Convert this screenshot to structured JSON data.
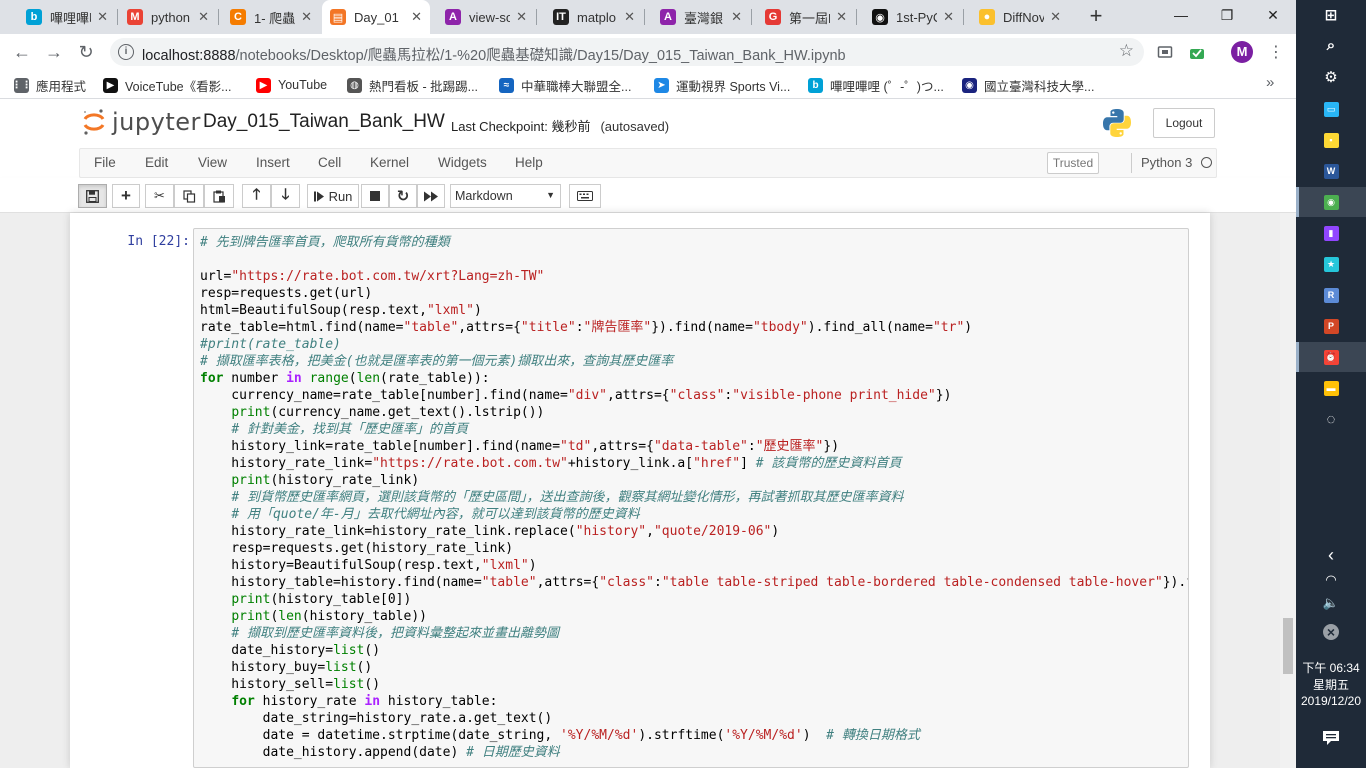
{
  "browser": {
    "tabs": [
      {
        "title": "嗶哩嗶哩",
        "icon": "bilibili-icon",
        "color": "#00a1d6",
        "glyph": "b"
      },
      {
        "title": "python",
        "icon": "gmail-icon",
        "color": "#ea4335",
        "glyph": "M"
      },
      {
        "title": "1- 爬蟲",
        "icon": "loading-icon",
        "color": "#f57c00",
        "glyph": "C"
      },
      {
        "title": "Day_01",
        "icon": "notebook-icon",
        "color": "#f37626",
        "glyph": "▤"
      },
      {
        "title": "view-so",
        "icon": "archive-icon",
        "color": "#8e24aa",
        "glyph": "A"
      },
      {
        "title": "matplo",
        "icon": "ithome-icon",
        "color": "#222222",
        "glyph": "IT"
      },
      {
        "title": "臺灣銀",
        "icon": "archive-icon",
        "color": "#8e24aa",
        "glyph": "A"
      },
      {
        "title": "第一屆P",
        "icon": "google-icon",
        "color": "#e53935",
        "glyph": "G"
      },
      {
        "title": "1st-PyC",
        "icon": "github-icon",
        "color": "#111111",
        "glyph": "◉"
      },
      {
        "title": "DiffNov",
        "icon": "lemon-icon",
        "color": "#fbc02d",
        "glyph": "●"
      }
    ],
    "window_controls": [
      "—",
      "❐",
      "✕"
    ],
    "url_host": "localhost:8888",
    "url_path": "/notebooks/Desktop/爬蟲馬拉松/1-%20爬蟲基礎知識/Day15/Day_015_Taiwan_Bank_HW.ipynb",
    "profile_initial": "M",
    "bookmarks": [
      {
        "label": "應用程式",
        "icon": "apps-grid-icon",
        "color": "#5f6368",
        "glyph": "⋮⋮"
      },
      {
        "label": "VoiceTube《看影...",
        "icon": "voicetube-icon",
        "color": "#111111",
        "glyph": "▶"
      },
      {
        "label": "YouTube",
        "icon": "youtube-icon",
        "color": "#ff0000",
        "glyph": "▶"
      },
      {
        "label": "熱門看板 - 批踢踢...",
        "icon": "globe-icon",
        "color": "#555555",
        "glyph": "◍"
      },
      {
        "label": "中華職棒大聯盟全...",
        "icon": "cpbl-icon",
        "color": "#1565c0",
        "glyph": "≈"
      },
      {
        "label": "運動視界 Sports Vi...",
        "icon": "sportsv-icon",
        "color": "#1e88e5",
        "glyph": "➤"
      },
      {
        "label": "嗶哩嗶哩 (゜-゜)つ...",
        "icon": "bilibili-icon",
        "color": "#00a1d6",
        "glyph": "b"
      },
      {
        "label": "國立臺灣科技大學...",
        "icon": "ntust-icon",
        "color": "#1a237e",
        "glyph": "◉"
      }
    ]
  },
  "jupyter": {
    "logo_text": "jupyter",
    "notebook_name": "Day_015_Taiwan_Bank_HW",
    "checkpoint_label": "Last Checkpoint: 幾秒前",
    "autosave": "(autosaved)",
    "logout_label": "Logout",
    "menus": [
      "File",
      "Edit",
      "View",
      "Insert",
      "Cell",
      "Kernel",
      "Widgets",
      "Help"
    ],
    "trusted_label": "Trusted",
    "kernel_name": "Python 3",
    "run_label": "Run",
    "cell_type": "Markdown",
    "prompt": "In [22]:",
    "code_lines": [
      [
        [
          "cm",
          "# 先到牌告匯率首頁，爬取所有貨幣的種類"
        ]
      ],
      [
        [
          "",
          ""
        ]
      ],
      [
        [
          "",
          "url="
        ],
        [
          "st",
          "\"https://rate.bot.com.tw/xrt?Lang=zh-TW\""
        ]
      ],
      [
        [
          "",
          "resp=requests.get(url)"
        ]
      ],
      [
        [
          "",
          "html=BeautifulSoup(resp.text,"
        ],
        [
          "st",
          "\"lxml\""
        ],
        [
          "",
          ")"
        ]
      ],
      [
        [
          "",
          "rate_table=html.find(name="
        ],
        [
          "st",
          "\"table\""
        ],
        [
          "",
          ",attrs={"
        ],
        [
          "st",
          "\"title\""
        ],
        [
          "",
          ":"
        ],
        [
          "st",
          "\"牌告匯率\""
        ],
        [
          "",
          "}).find(name="
        ],
        [
          "st",
          "\"tbody\""
        ],
        [
          "",
          ").find_all(name="
        ],
        [
          "st",
          "\"tr\""
        ],
        [
          "",
          ")"
        ]
      ],
      [
        [
          "cm",
          "#print(rate_table)"
        ]
      ],
      [
        [
          "cm",
          "# 擷取匯率表格，把美金(也就是匯率表的第一個元素)擷取出來，查詢其歷史匯率"
        ]
      ],
      [
        [
          "kw",
          "for"
        ],
        [
          "",
          " number "
        ],
        [
          "op",
          "in"
        ],
        [
          "",
          " "
        ],
        [
          "bi",
          "range"
        ],
        [
          "",
          "("
        ],
        [
          "bi",
          "len"
        ],
        [
          "",
          "(rate_table)):"
        ]
      ],
      [
        [
          "",
          "    currency_name=rate_table[number].find(name="
        ],
        [
          "st",
          "\"div\""
        ],
        [
          "",
          ",attrs={"
        ],
        [
          "st",
          "\"class\""
        ],
        [
          "",
          ":"
        ],
        [
          "st",
          "\"visible-phone print_hide\""
        ],
        [
          "",
          "})"
        ]
      ],
      [
        [
          "",
          "    "
        ],
        [
          "bi",
          "print"
        ],
        [
          "",
          "(currency_name.get_text().lstrip())"
        ]
      ],
      [
        [
          "",
          "    "
        ],
        [
          "cm",
          "# 針對美金，找到其「歷史匯率」的首頁"
        ]
      ],
      [
        [
          "",
          "    history_link=rate_table[number].find(name="
        ],
        [
          "st",
          "\"td\""
        ],
        [
          "",
          ",attrs={"
        ],
        [
          "st",
          "\"data-table\""
        ],
        [
          "",
          ":"
        ],
        [
          "st",
          "\"歷史匯率\""
        ],
        [
          "",
          "})"
        ]
      ],
      [
        [
          "",
          "    history_rate_link="
        ],
        [
          "st",
          "\"https://rate.bot.com.tw\""
        ],
        [
          "",
          "+history_link.a["
        ],
        [
          "st",
          "\"href\""
        ],
        [
          "",
          "] "
        ],
        [
          "cm",
          "# 該貨幣的歷史資料首頁"
        ]
      ],
      [
        [
          "",
          "    "
        ],
        [
          "bi",
          "print"
        ],
        [
          "",
          "(history_rate_link)"
        ]
      ],
      [
        [
          "",
          "    "
        ],
        [
          "cm",
          "# 到貨幣歷史匯率網頁，選則該貨幣的「歷史區間」，送出查詢後，觀察其網址變化情形，再試著抓取其歷史匯率資料"
        ]
      ],
      [
        [
          "",
          "    "
        ],
        [
          "cm",
          "# 用「quote/年-月」去取代網址內容，就可以達到該貨幣的歷史資料"
        ]
      ],
      [
        [
          "",
          "    history_rate_link=history_rate_link.replace("
        ],
        [
          "st",
          "\"history\""
        ],
        [
          "",
          ","
        ],
        [
          "st",
          "\"quote/2019-06\""
        ],
        [
          "",
          ")"
        ]
      ],
      [
        [
          "",
          "    resp=requests.get(history_rate_link)"
        ]
      ],
      [
        [
          "",
          "    history=BeautifulSoup(resp.text,"
        ],
        [
          "st",
          "\"lxml\""
        ],
        [
          "",
          ")"
        ]
      ],
      [
        [
          "",
          "    history_table=history.find(name="
        ],
        [
          "st",
          "\"table\""
        ],
        [
          "",
          ",attrs={"
        ],
        [
          "st",
          "\"class\""
        ],
        [
          "",
          ":"
        ],
        [
          "st",
          "\"table table-striped table-bordered table-condensed table-hover\""
        ],
        [
          "",
          "}).fin"
        ]
      ],
      [
        [
          "",
          "    "
        ],
        [
          "bi",
          "print"
        ],
        [
          "",
          "(history_table[0])"
        ]
      ],
      [
        [
          "",
          "    "
        ],
        [
          "bi",
          "print"
        ],
        [
          "",
          "("
        ],
        [
          "bi",
          "len"
        ],
        [
          "",
          "(history_table))"
        ]
      ],
      [
        [
          "",
          "    "
        ],
        [
          "cm",
          "# 擷取到歷史匯率資料後，把資料彙整起來並畫出離勢圖"
        ]
      ],
      [
        [
          "",
          "    date_history="
        ],
        [
          "bi",
          "list"
        ],
        [
          "",
          "()"
        ]
      ],
      [
        [
          "",
          "    history_buy="
        ],
        [
          "bi",
          "list"
        ],
        [
          "",
          "()"
        ]
      ],
      [
        [
          "",
          "    history_sell="
        ],
        [
          "bi",
          "list"
        ],
        [
          "",
          "()"
        ]
      ],
      [
        [
          "",
          "    "
        ],
        [
          "kw",
          "for"
        ],
        [
          "",
          " history_rate "
        ],
        [
          "op",
          "in"
        ],
        [
          "",
          " history_table:"
        ]
      ],
      [
        [
          "",
          "        date_string=history_rate.a.get_text()"
        ]
      ],
      [
        [
          "",
          "        date = datetime.strptime(date_string, "
        ],
        [
          "st",
          "'%Y/%M/%d'"
        ],
        [
          "",
          ").strftime("
        ],
        [
          "st",
          "'%Y/%M/%d'"
        ],
        [
          "",
          ")  "
        ],
        [
          "cm",
          "# 轉換日期格式"
        ]
      ],
      [
        [
          "",
          "        date_history.append(date) "
        ],
        [
          "cm",
          "# 日期歷史資料"
        ]
      ]
    ]
  },
  "taskbar": {
    "time": "下午 06:34",
    "weekday": "星期五",
    "date": "2019/12/20",
    "apps": [
      {
        "name": "windows-start-icon",
        "glyph": "⊞",
        "color": "#1f2a38"
      },
      {
        "name": "search-icon",
        "glyph": "⌕",
        "color": "#1f2a38"
      },
      {
        "name": "settings-gear-icon",
        "glyph": "⚙",
        "color": "#1f2a38"
      },
      {
        "name": "monitor-icon",
        "glyph": "▭",
        "color": "#29b6f6"
      },
      {
        "name": "sticky-notes-icon",
        "glyph": "▪",
        "color": "#fdd835"
      },
      {
        "name": "word-icon",
        "glyph": "W",
        "color": "#2b579a"
      },
      {
        "name": "chrome-icon",
        "glyph": "◉",
        "color": "#4caf50"
      },
      {
        "name": "twitch-icon",
        "glyph": "▮",
        "color": "#9146ff"
      },
      {
        "name": "star-app-icon",
        "glyph": "★",
        "color": "#26c6da"
      },
      {
        "name": "r-app-icon",
        "glyph": "R",
        "color": "#5c8bd6"
      },
      {
        "name": "powerpoint-icon",
        "glyph": "P",
        "color": "#d24726"
      },
      {
        "name": "timer-app-icon",
        "glyph": "⏰",
        "color": "#f44336"
      },
      {
        "name": "file-explorer-icon",
        "glyph": "▬",
        "color": "#ffc107"
      },
      {
        "name": "loading-circle-icon",
        "glyph": "◌",
        "color": "#1f2a38"
      }
    ]
  }
}
